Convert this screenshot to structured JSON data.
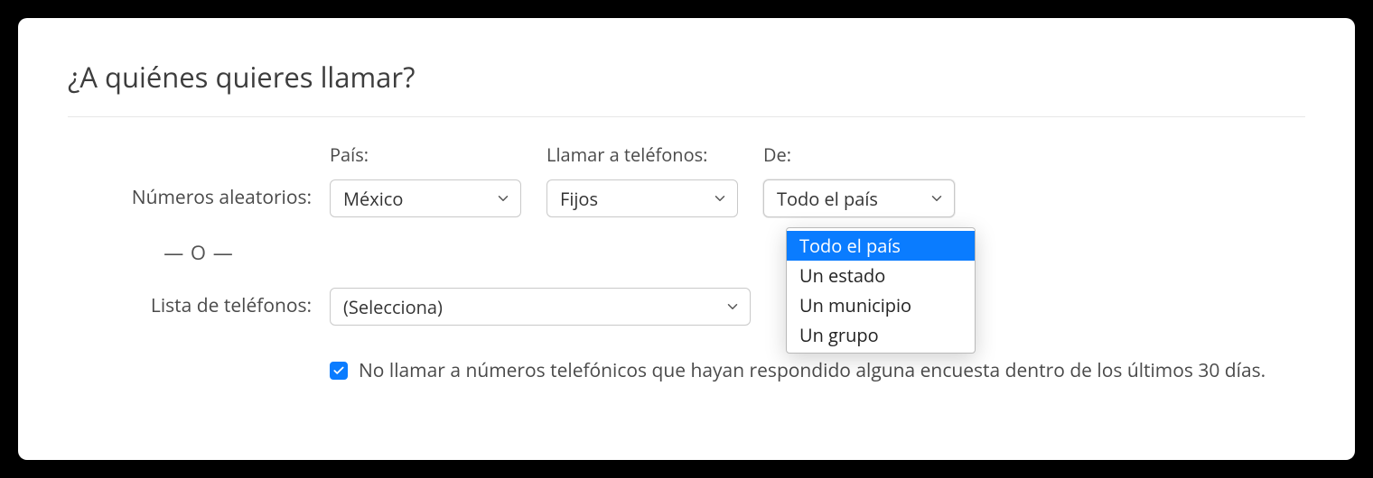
{
  "title": "¿A quiénes quieres llamar?",
  "labels": {
    "random_numbers": "Números aleatorios:",
    "country": "País:",
    "call_phones": "Llamar a teléfonos:",
    "from": "De:",
    "or": "— O —",
    "phone_list": "Lista de teléfonos:"
  },
  "selects": {
    "country": "México",
    "phones": "Fijos",
    "region": "Todo el país",
    "list": "(Selecciona)"
  },
  "region_options": [
    "Todo el país",
    "Un estado",
    "Un municipio",
    "Un grupo"
  ],
  "checkbox": {
    "checked": true,
    "label": "No llamar a números telefónicos que hayan respondido alguna encuesta dentro de los últimos 30 días."
  }
}
